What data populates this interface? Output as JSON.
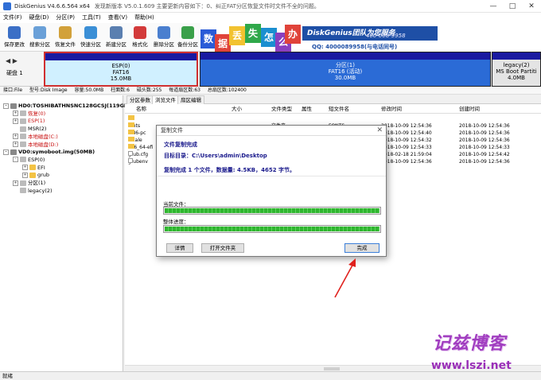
{
  "window": {
    "title": "DiskGenius V4.6.6.564 x64",
    "notice": "发现新版本 V5.0.1.609 主要更新内容如下：0、纠正FAT分区恢复文件时文件不全的问题。"
  },
  "menu": [
    "文件(F)",
    "硬盘(D)",
    "分区(P)",
    "工具(T)",
    "查看(V)",
    "帮助(H)"
  ],
  "toolbar": [
    {
      "label": "保存更改",
      "icon": "save-icon",
      "color": "#3b6fc6"
    },
    {
      "label": "搜索分区",
      "icon": "search-icon",
      "color": "#6aa0d8"
    },
    {
      "label": "恢复文件",
      "icon": "recover-icon",
      "color": "#d2a13a"
    },
    {
      "label": "快速分区",
      "icon": "quick-partition-icon",
      "color": "#3b8fd6"
    },
    {
      "label": "新建分区",
      "icon": "new-partition-icon",
      "color": "#5a7fb0"
    },
    {
      "label": "格式化",
      "icon": "format-icon",
      "color": "#d33a3a"
    },
    {
      "label": "删除分区",
      "icon": "delete-partition-icon",
      "color": "#4a7fcf"
    },
    {
      "label": "备份分区",
      "icon": "backup-icon",
      "color": "#3aa04a"
    }
  ],
  "banner": {
    "chars": [
      {
        "t": "数",
        "bg": "#2a5bd7"
      },
      {
        "t": "据",
        "bg": "#e0433a"
      },
      {
        "t": "丢",
        "bg": "#f2c230"
      },
      {
        "t": "失",
        "bg": "#2fa84a"
      },
      {
        "t": "怎",
        "bg": "#1b8fd0"
      },
      {
        "t": "么",
        "bg": "#8a3fbf"
      },
      {
        "t": "办",
        "bg": "#e0433a"
      }
    ],
    "brand": "DiskGenius团队为您服务",
    "phone": "400-008-9958",
    "qq": "QQ: 4000089958(与电话同号)"
  },
  "diskmap": {
    "disk_label": "硬盘 1",
    "segments": [
      {
        "name": "ESP(0)",
        "fs": "FAT16",
        "size": "15.0MB"
      },
      {
        "name": "分区(1)",
        "fs": "FAT16 (活动)",
        "size": "30.0MB"
      },
      {
        "name": "legacy(2)",
        "fs": "MS Boot Partiti",
        "size": "4.0MB"
      }
    ]
  },
  "infobar": {
    "iface": "接口:File",
    "model": "型号:Disk Image",
    "capacity": "容量:50.0MB",
    "cyl": "柱面数:6",
    "heads": "磁头数:255",
    "spt": "每道扇区数:63",
    "total": "总扇区数:102400"
  },
  "tree": [
    {
      "text": "HD0:TOSHIBATHNSNC128GCSJ(119GB)",
      "depth": 0,
      "bold": true,
      "red": false,
      "icon": "hdd-icon",
      "ex": "-"
    },
    {
      "text": "恢复(0)",
      "depth": 1,
      "bold": false,
      "red": true,
      "icon": "partition-icon",
      "ex": "+"
    },
    {
      "text": "ESP(1)",
      "depth": 1,
      "bold": false,
      "red": true,
      "icon": "partition-icon",
      "ex": "+"
    },
    {
      "text": "MSR(2)",
      "depth": 1,
      "bold": false,
      "red": false,
      "icon": "partition-icon",
      "ex": ""
    },
    {
      "text": "本地磁盘(C:)",
      "depth": 1,
      "bold": false,
      "red": true,
      "icon": "partition-icon",
      "ex": "+"
    },
    {
      "text": "本地磁盘(D:)",
      "depth": 1,
      "bold": false,
      "red": true,
      "icon": "partition-icon",
      "ex": "+"
    },
    {
      "text": "VD0:symoboot.img(50MB)",
      "depth": 0,
      "bold": true,
      "red": false,
      "icon": "hdd-icon",
      "ex": "-"
    },
    {
      "text": "ESP(0)",
      "depth": 1,
      "bold": false,
      "red": false,
      "icon": "partition-icon",
      "ex": "-"
    },
    {
      "text": "EFI",
      "depth": 2,
      "bold": false,
      "red": false,
      "icon": "folder-icon",
      "ex": "+"
    },
    {
      "text": "grub",
      "depth": 2,
      "bold": false,
      "red": false,
      "icon": "folder-icon",
      "ex": "+"
    },
    {
      "text": "分区(1)",
      "depth": 1,
      "bold": false,
      "red": false,
      "icon": "partition-icon",
      "ex": "+"
    },
    {
      "text": "legacy(2)",
      "depth": 1,
      "bold": false,
      "red": false,
      "icon": "partition-icon",
      "ex": ""
    }
  ],
  "tabs": [
    "分区参数",
    "浏览文件",
    "扇区编辑"
  ],
  "columns": [
    "名称",
    "大小",
    "文件类型",
    "属性",
    "短文件名",
    "修改时间",
    "创建时间"
  ],
  "files": [
    {
      "name": "..",
      "type": "",
      "attr": "",
      "short": "",
      "mtime": "",
      "ctime": "",
      "doc": false
    },
    {
      "name": "fonts",
      "type": "文件夹",
      "attr": "",
      "short": "FONTS",
      "mtime": "2018-10-09 12:54:36",
      "ctime": "2018-10-09 12:54:36",
      "doc": false
    },
    {
      "name": "i386-pc",
      "type": "",
      "attr": "",
      "short": "",
      "mtime": "2018-10-09 12:54:40",
      "ctime": "2018-10-09 12:54:36",
      "doc": false
    },
    {
      "name": "locale",
      "type": "",
      "attr": "",
      "short": "",
      "mtime": "2018-10-09 12:54:32",
      "ctime": "2018-10-09 12:54:36",
      "doc": false
    },
    {
      "name": "x86_64-efi",
      "type": "",
      "attr": "",
      "short": "",
      "mtime": "2018-10-09 12:54:33",
      "ctime": "2018-10-09 12:54:33",
      "doc": false
    },
    {
      "name": "grub.cfg",
      "type": "",
      "attr": "",
      "short": "",
      "mtime": "2018-02-18 21:59:04",
      "ctime": "2018-10-09 12:54:42",
      "doc": true
    },
    {
      "name": "grubenv",
      "type": "",
      "attr": "",
      "short": "",
      "mtime": "2018-10-09 12:54:36",
      "ctime": "2018-10-09 12:54:36",
      "doc": true
    }
  ],
  "dialog": {
    "title": "复制文件",
    "done_text": "文件复制完成",
    "target": "目标目录：C:\\Users\\admin\\Desktop",
    "summary": "复制完成 1 个文件，数据量: 4.5KB，4652 字节。",
    "current_label": "当前文件：",
    "current_progress": 1.0,
    "overall_label": "整体进度：",
    "overall_progress": 1.0,
    "btn_details": "详情",
    "btn_open": "打开文件夹",
    "btn_done": "完成"
  },
  "status": "就绪",
  "watermark": {
    "line1": "记兹博客",
    "line2": "www.lszi.net"
  }
}
